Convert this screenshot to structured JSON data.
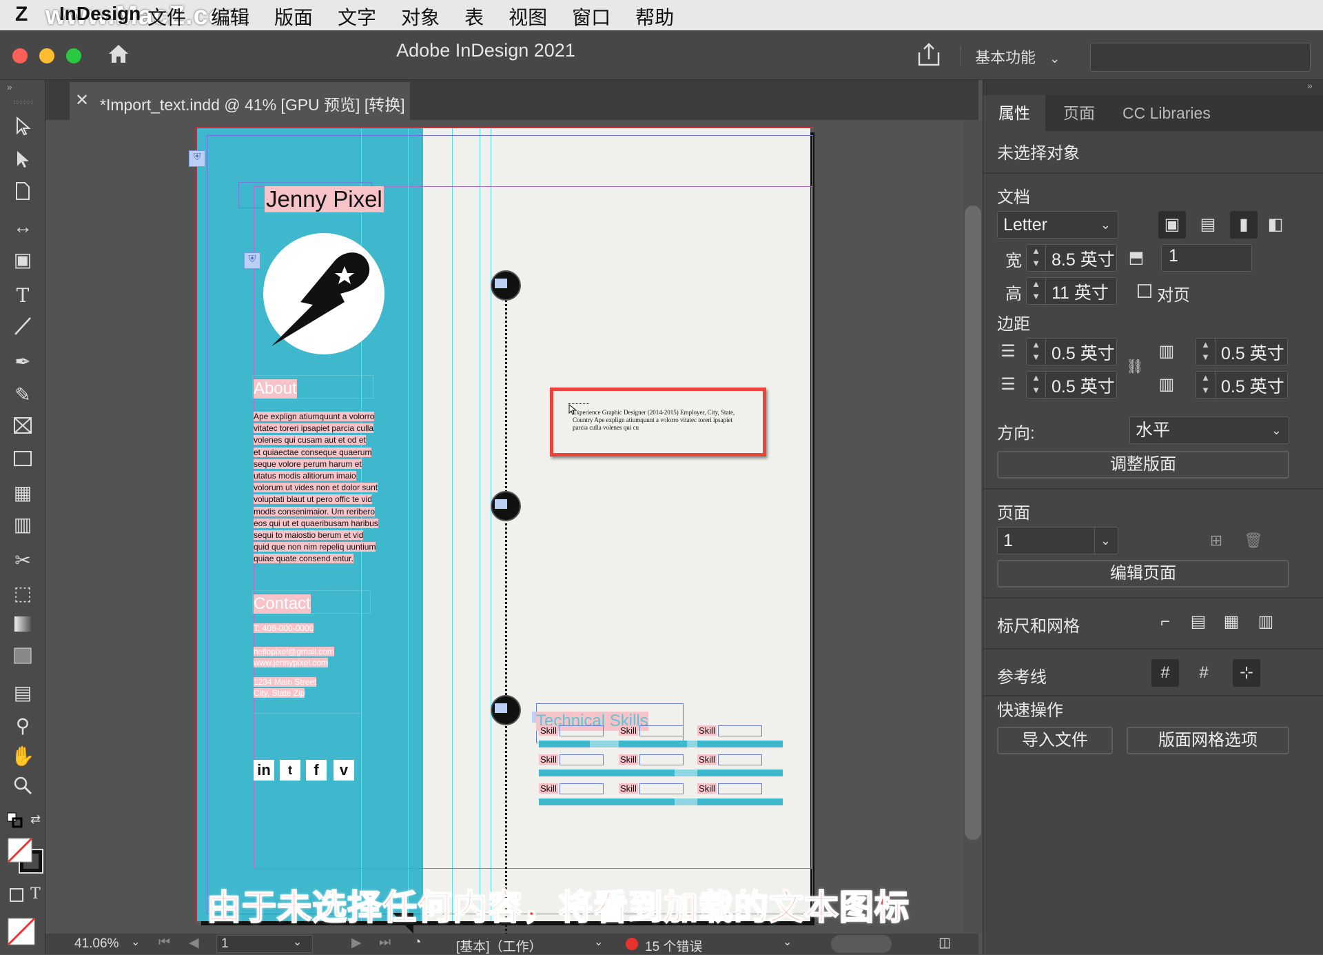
{
  "menubar": {
    "watermark": "www.MacZ.com",
    "app_name": "InDesign",
    "items": [
      "文件",
      "编辑",
      "版面",
      "文字",
      "对象",
      "表",
      "视图",
      "窗口",
      "帮助"
    ]
  },
  "titlebar": {
    "title": "Adobe InDesign 2021",
    "workspace": "基本功能"
  },
  "document_tab": {
    "label": "*Import_text.indd @ 41% [GPU 预览] [转换]"
  },
  "resume": {
    "name": "Jenny Pixel",
    "about_heading": "About",
    "about_lines": [
      "Ape explign atiumquunt a volorro",
      "vitatec toreri ipsapiet parcia culla",
      "volenes qui cusam aut et od et",
      "et quiaectae conseque quaerum",
      "seque volore perum harum et",
      "utatus modis alitiorum imaio",
      "volorum ut vides non et dolor sunt",
      "voluptati blaut ut pero offic te vid",
      "modis consenimaior. Um reribero",
      "eos qui ut et quaeribusam haribus",
      "sequi to maiostio berum et vid",
      "quid que non nim repeliq uuntium",
      "quiae quate consend entur."
    ],
    "contact_heading": "Contact",
    "contact_phone": "T: 408-000-0000",
    "contact_email": "hellopixel@gmail.com",
    "contact_web": "www.jennypixel.com",
    "contact_street": "1234 Main Street",
    "contact_city": "City, State Zip",
    "social_icons": [
      "in",
      "t",
      "f",
      "v"
    ],
    "experience_text": "Experience  Graphic Designer (2014-2015) Employer, City, State, Country  Ape explign atiumquunt a volorro vitatec toreri ipsapiet parcia culla volenes qui cu",
    "skills_heading": "Technical Skills",
    "skills": [
      {
        "label": "Skill",
        "level": 0.6
      },
      {
        "label": "Skill",
        "level": 0.8
      },
      {
        "label": "Skill",
        "level": 1.0
      },
      {
        "label": "Skill",
        "level": 1.0
      },
      {
        "label": "Skill",
        "level": 0.65
      },
      {
        "label": "Skill",
        "level": 1.0
      },
      {
        "label": "Skill",
        "level": 1.0
      },
      {
        "label": "Skill",
        "level": 0.65
      },
      {
        "label": "Skill",
        "level": 1.0
      }
    ]
  },
  "caption": "由于未选择任何内容，将看到加载的文本图标",
  "statusbar": {
    "zoom": "41.06%",
    "page": "1",
    "profile": "[基本]（工作）",
    "errors": "15 个错误"
  },
  "panel": {
    "tabs": [
      "属性",
      "页面",
      "CC Libraries"
    ],
    "no_selection": "未选择对象",
    "document_title": "文档",
    "page_size": "Letter",
    "width_label": "宽",
    "width_value": "8.5 英寸",
    "height_label": "高",
    "height_value": "11 英寸",
    "pages_count": "1",
    "facing_pages": "对页",
    "margins_title": "边距",
    "margin_top": "0.5 英寸",
    "margin_bottom": "0.5 英寸",
    "margin_left": "0.5 英寸",
    "margin_right": "0.5 英寸",
    "orientation_label": "方向:",
    "orientation_value": "水平",
    "adjust_layout": "调整版面",
    "page_title": "页面",
    "page_value": "1",
    "edit_page": "编辑页面",
    "rulers_grids": "标尺和网格",
    "guides": "参考线",
    "quick_actions": "快速操作",
    "import_file": "导入文件",
    "layout_grid_options": "版面网格选项"
  },
  "colors": {
    "sidebar": "#3fb7cd",
    "highlight": "#f6c3c9",
    "callout": "#e8453c",
    "caption": "#f3423c"
  }
}
